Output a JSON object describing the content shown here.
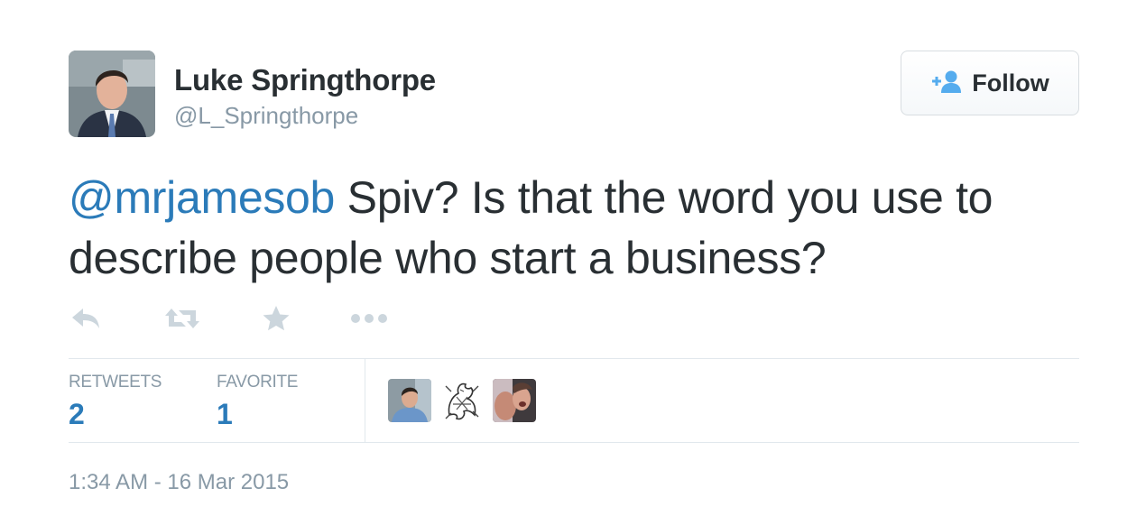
{
  "user": {
    "name": "Luke Springthorpe",
    "handle": "@L_Springthorpe"
  },
  "follow_button": {
    "label": "Follow",
    "icon": "add-user-icon"
  },
  "tweet": {
    "mention": "@mrjamesob",
    "text": " Spiv? Is that the word you use to describe people who start a business?"
  },
  "actions": {
    "icons": [
      "reply-icon",
      "retweet-icon",
      "favorite-star-icon",
      "more-icon"
    ]
  },
  "stats": {
    "retweets_label": "RETWEETS",
    "retweets_count": "2",
    "favorites_label": "FAVORITE",
    "favorites_count": "1"
  },
  "timestamp": "1:34 AM - 16 Mar 2015",
  "colors": {
    "link": "#2b7bb9",
    "text": "#292f33",
    "muted": "#8899a6",
    "border": "#e1e8ed"
  }
}
